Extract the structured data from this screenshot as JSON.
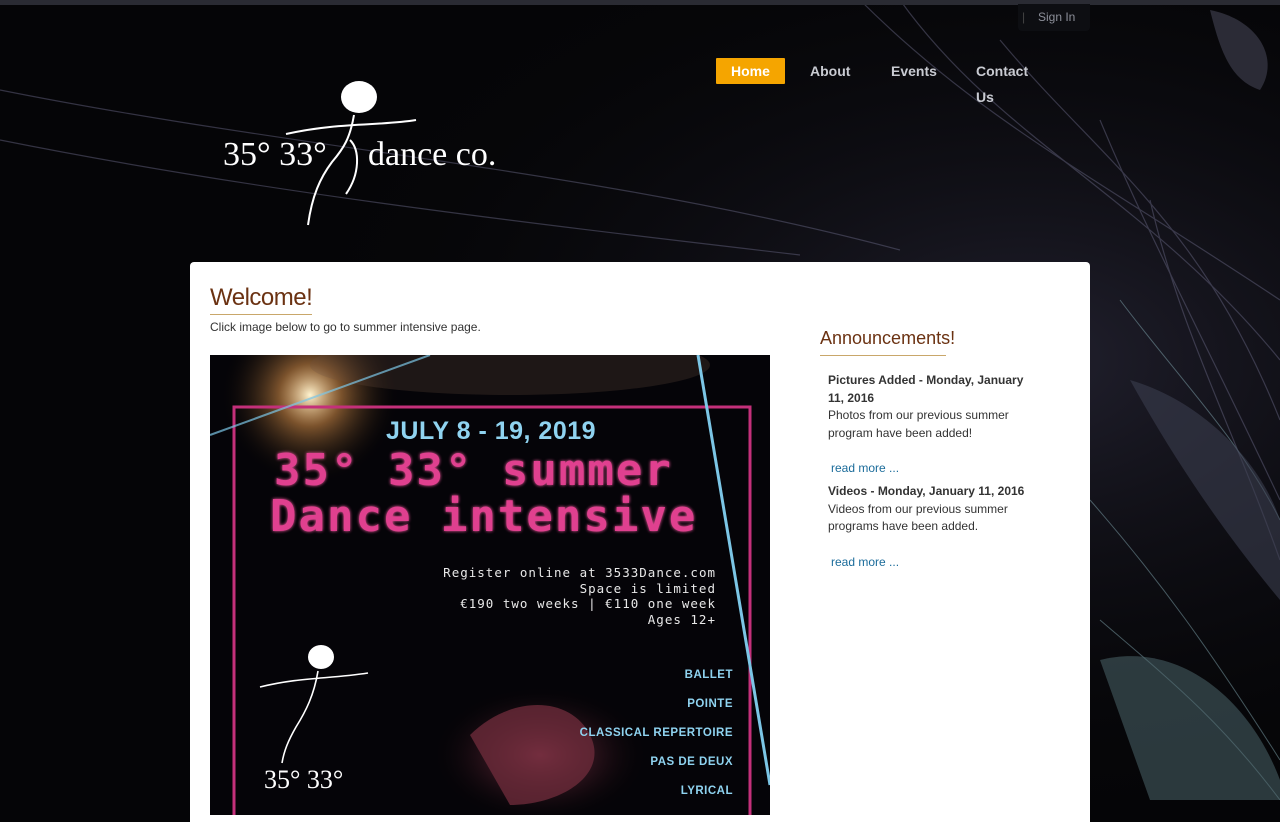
{
  "header": {
    "sign_in": "Sign In",
    "sign_in_separator": "|",
    "nav": [
      {
        "label": "Home",
        "active": true
      },
      {
        "label": "About",
        "active": false
      },
      {
        "label": "Events",
        "active": false
      },
      {
        "label": "Contact Us",
        "active": false
      }
    ],
    "logo": {
      "degrees": "35° 33°",
      "name": "dance co."
    }
  },
  "main": {
    "heading": "Welcome!",
    "intro": "Click image below to go to summer intensive page.",
    "poster": {
      "date": "JULY 8 - 19, 2019",
      "title_line1": "35° 33° summer",
      "title_line2": "Dance intensive",
      "info": [
        "Register online at 3533Dance.com",
        "Space is limited",
        "€190 two weeks | €110 one week",
        "Ages 12+"
      ],
      "classes": [
        "BALLET",
        "POINTE",
        "CLASSICAL REPERTOIRE",
        "PAS DE DEUX",
        "LYRICAL"
      ],
      "brand": "35° 33°"
    }
  },
  "sidebar": {
    "title": "Announcements!",
    "items": [
      {
        "title": "Pictures Added",
        "date": "- Monday, January 11, 2016",
        "body": "Photos from our previous summer program have been added!",
        "link": "read more ..."
      },
      {
        "title": "Videos",
        "date": "- Monday, January 11, 2016",
        "body": "Videos from our previous summer programs have been added.",
        "link": "read more ..."
      }
    ]
  },
  "colors": {
    "accent": "#f5a500",
    "heading": "#6b3212",
    "link": "#1a6b9a",
    "poster_pink": "#e0408f",
    "poster_blue": "#8fd3f0"
  }
}
